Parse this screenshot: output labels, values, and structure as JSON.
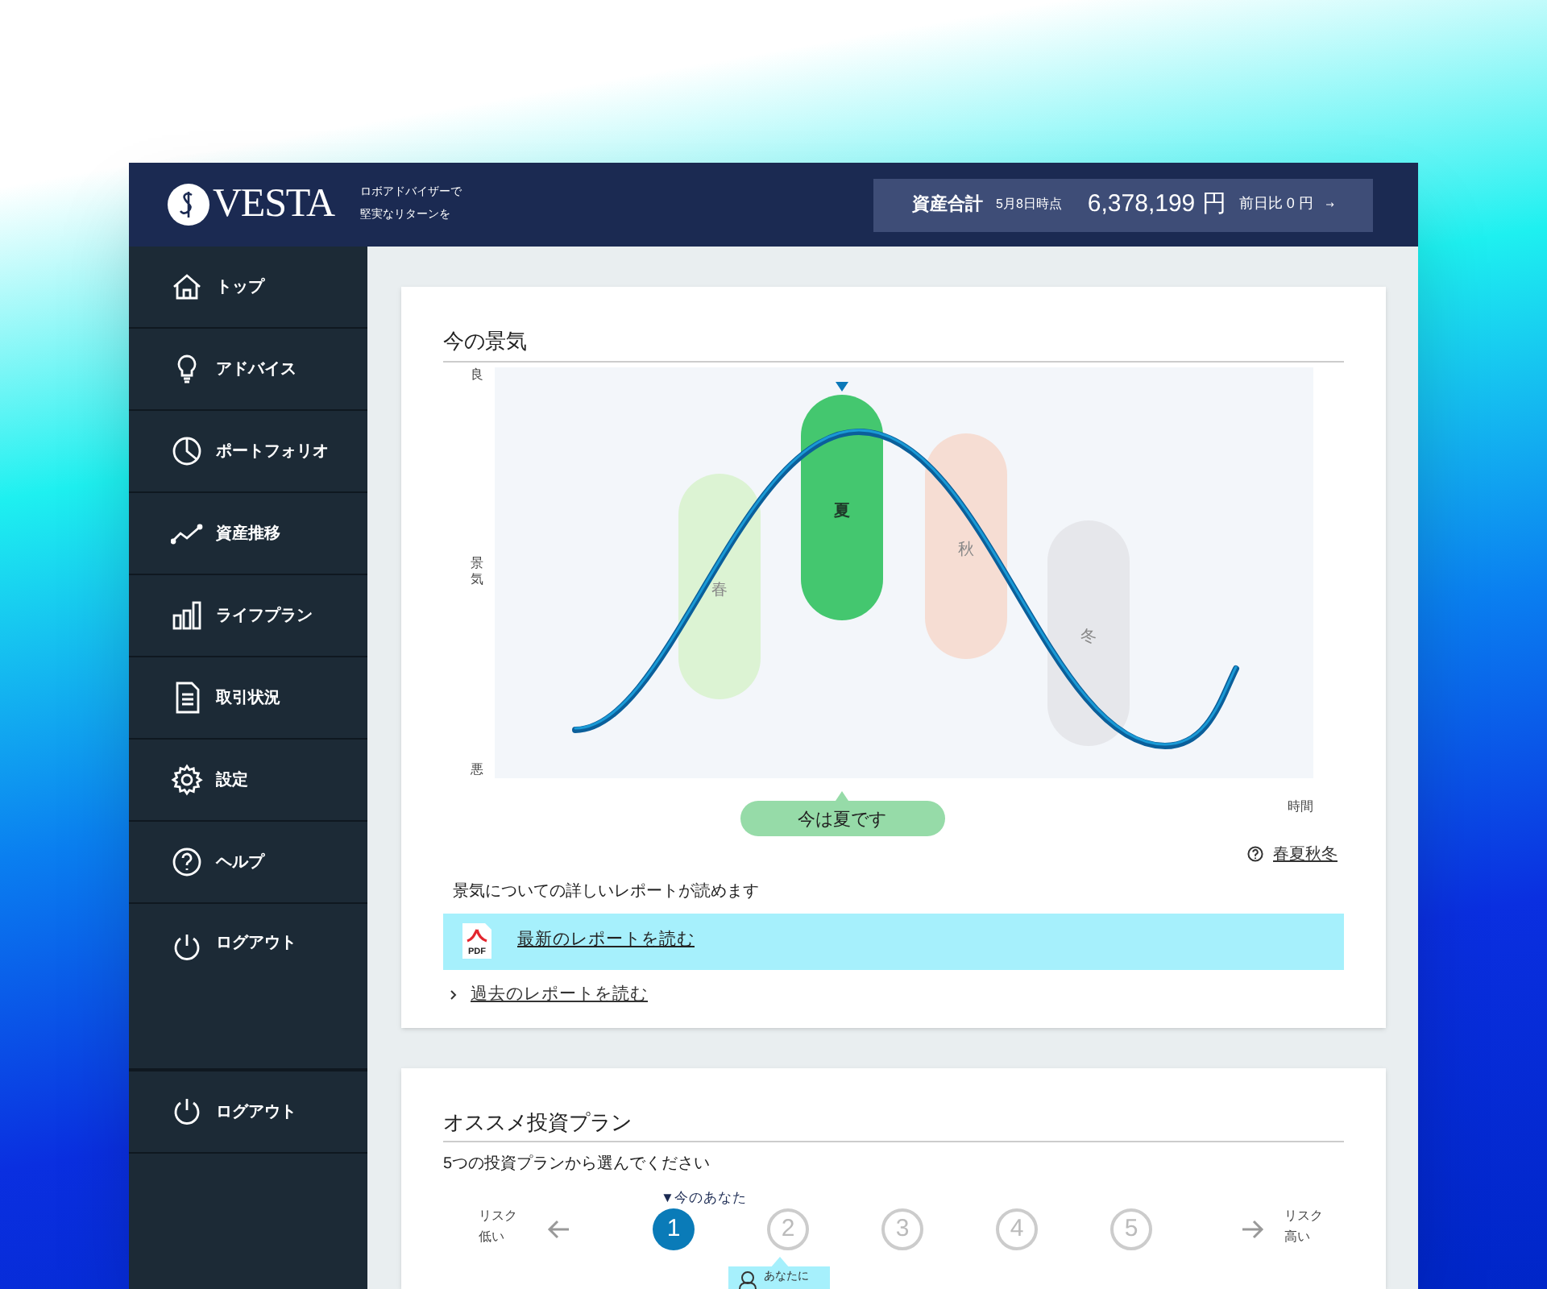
{
  "header": {
    "logo": "VESTA",
    "tagline": [
      "ロボアドバイザーで",
      "堅実なリターンを"
    ],
    "total_label": "資産合計",
    "as_of": "5月8日時点",
    "total": "6,378,199 円",
    "change": "前日比 0 円"
  },
  "sidebar": {
    "items": [
      {
        "label": "トップ"
      },
      {
        "label": "アドバイス"
      },
      {
        "label": "ポートフォリオ"
      },
      {
        "label": "資産推移"
      },
      {
        "label": "ライフプラン"
      },
      {
        "label": "取引状況"
      },
      {
        "label": "設定"
      },
      {
        "label": "ヘルプ"
      },
      {
        "label": "ログアウト"
      }
    ],
    "lower_items": [
      {
        "label": "ログアウト"
      }
    ]
  },
  "economy": {
    "title": "今の景気",
    "y_labels": [
      "良",
      "景気",
      "悪"
    ],
    "x_label": "時間",
    "seasons": [
      {
        "label": "春",
        "color": "#dcf3d3",
        "selected": false
      },
      {
        "label": "夏",
        "color": "#44c76f",
        "selected": true
      },
      {
        "label": "秋",
        "color": "#f6ddd3",
        "selected": false
      },
      {
        "label": "冬",
        "color": "#e6e7eb",
        "selected": false
      }
    ],
    "current": "今は夏です",
    "pdf_badge": "PDF",
    "help_link": "春夏秋冬",
    "report_note": "景気についての詳しいレポートが読めます",
    "latest_report": "最新のレポートを読む",
    "past_reports": "過去のレポートを読む"
  },
  "plans": {
    "title": "オススメ投資プラン",
    "instruction": "5つの投資プランから選んでください",
    "current_marker": "▼今のあなた",
    "low_risk": [
      "リスク",
      "低い"
    ],
    "high_risk": [
      "リスク",
      "高い"
    ],
    "steps": [
      {
        "label": "1",
        "selected": true
      },
      {
        "label": "2",
        "selected": false
      },
      {
        "label": "3",
        "selected": false
      },
      {
        "label": "4",
        "selected": false
      },
      {
        "label": "5",
        "selected": false
      }
    ],
    "recommend_tip": "あなたに"
  }
}
